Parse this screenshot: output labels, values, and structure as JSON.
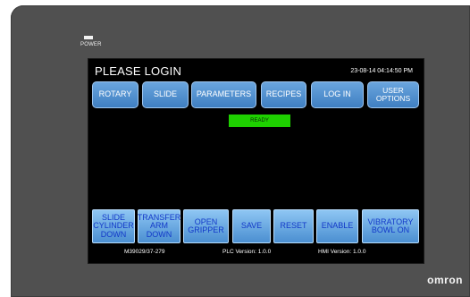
{
  "device": {
    "power_label": "POWER",
    "brand": "omron"
  },
  "screen": {
    "title": "PLEASE LOGIN",
    "datetime": "23-08-14 04:14:50 PM",
    "status": "READY",
    "top_buttons": [
      "ROTARY",
      "SLIDE",
      "PARAMETERS",
      "RECIPES",
      "LOG IN",
      "USER\nOPTIONS"
    ],
    "bottom_buttons": [
      "SLIDE\nCYLINDER\nDOWN",
      "TRANSFER\nARM\nDOWN",
      "OPEN\nGRIPPER",
      "SAVE",
      "RESET",
      "ENABLE",
      "VIBRATORY\nBOWL ON"
    ],
    "footer": {
      "model": "M39029/37-279",
      "plc_version": "PLC Version: 1.0.0",
      "hmi_version": "HMI Version: 1.0.0"
    }
  },
  "colors": {
    "bezel": "#505050",
    "screen_bg": "#000000",
    "top_button": "#4f8fd0",
    "bottom_button": "#7fb7ee",
    "bottom_text": "#1238c8",
    "status_bg": "#1ed000"
  }
}
